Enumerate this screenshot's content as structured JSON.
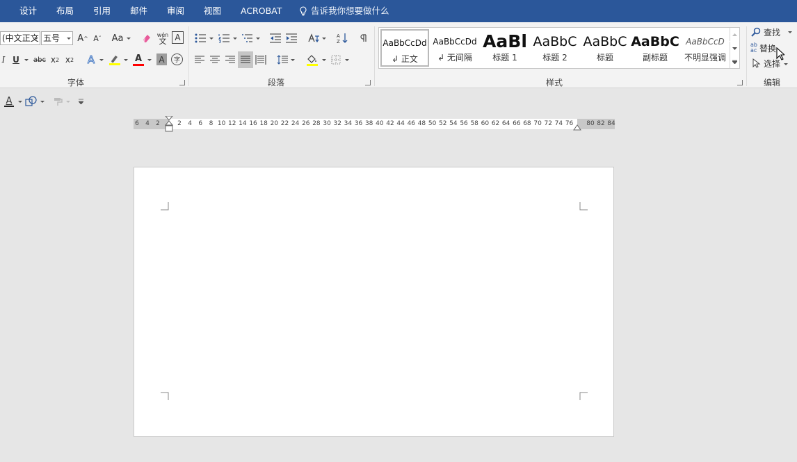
{
  "menu": {
    "items": [
      "设计",
      "布局",
      "引用",
      "邮件",
      "审阅",
      "视图",
      "ACROBAT"
    ],
    "tellme": "告诉我你想要做什么"
  },
  "font_group": {
    "font_name": "(中文正文",
    "font_size": "五号",
    "label": "字体",
    "buttons": {
      "grow": "A",
      "shrink": "A",
      "case": "Aa",
      "phonetic_top": "wén",
      "phonetic_bottom": "文",
      "border_char": "A",
      "italic": "I",
      "underline": "U",
      "strikethrough": "abc",
      "subscript": "x",
      "subscript_mark": "2",
      "superscript": "x",
      "superscript_mark": "2",
      "text_effect": "A",
      "font_color": "A",
      "shading": "A",
      "enclose": "字"
    }
  },
  "paragraph_group": {
    "label": "段落"
  },
  "styles_group": {
    "label": "样式",
    "items": [
      {
        "preview": "AaBbCcDd",
        "name": "↲ 正文"
      },
      {
        "preview": "AaBbCcDd",
        "name": "↲ 无间隔"
      },
      {
        "preview": "AaBl",
        "name": "标题 1"
      },
      {
        "preview": "AaBbC",
        "name": "标题 2"
      },
      {
        "preview": "AaBbC",
        "name": "标题"
      },
      {
        "preview": "AaBbC",
        "name": "副标题"
      },
      {
        "preview": "AaBbCcD",
        "name": "不明显强调"
      }
    ]
  },
  "editing_group": {
    "label": "编辑",
    "find": "查找",
    "replace": "替换",
    "select": "选择",
    "replace_icon_top": "ab",
    "replace_icon_bottom": "ac"
  },
  "qat": {
    "font_color": "A"
  },
  "ruler": {
    "ticks": [
      "6",
      "4",
      "2",
      "2",
      "4",
      "6",
      "8",
      "10",
      "12",
      "14",
      "16",
      "18",
      "20",
      "22",
      "24",
      "26",
      "28",
      "30",
      "32",
      "34",
      "36",
      "38",
      "40",
      "42",
      "44",
      "46",
      "48",
      "50",
      "52",
      "54",
      "56",
      "58",
      "60",
      "62",
      "64",
      "66",
      "68",
      "70",
      "72",
      "74",
      "76",
      "80",
      "82",
      "84"
    ]
  },
  "colors": {
    "title_bar": "#2b579a",
    "ribbon_bg": "#f3f3f3",
    "workspace_bg": "#e6e6e6",
    "highlight_yellow": "#ffff00",
    "font_color_red": "#ff0000",
    "accent_blue": "#2b579a"
  },
  "icons": [
    "lightbulb-icon",
    "eraser-icon",
    "bullets-icon",
    "numbering-icon",
    "multilevel-icon",
    "decrease-indent-icon",
    "increase-indent-icon",
    "chinese-layout-icon",
    "sort-icon",
    "show-marks-icon",
    "align-left-icon",
    "center-icon",
    "align-right-icon",
    "justify-icon",
    "distributed-icon",
    "line-spacing-icon",
    "shading-bucket-icon",
    "borders-icon",
    "search-icon",
    "replace-icon",
    "cursor-icon",
    "shapes-icon",
    "format-painter-icon",
    "customize-qat-icon"
  ]
}
